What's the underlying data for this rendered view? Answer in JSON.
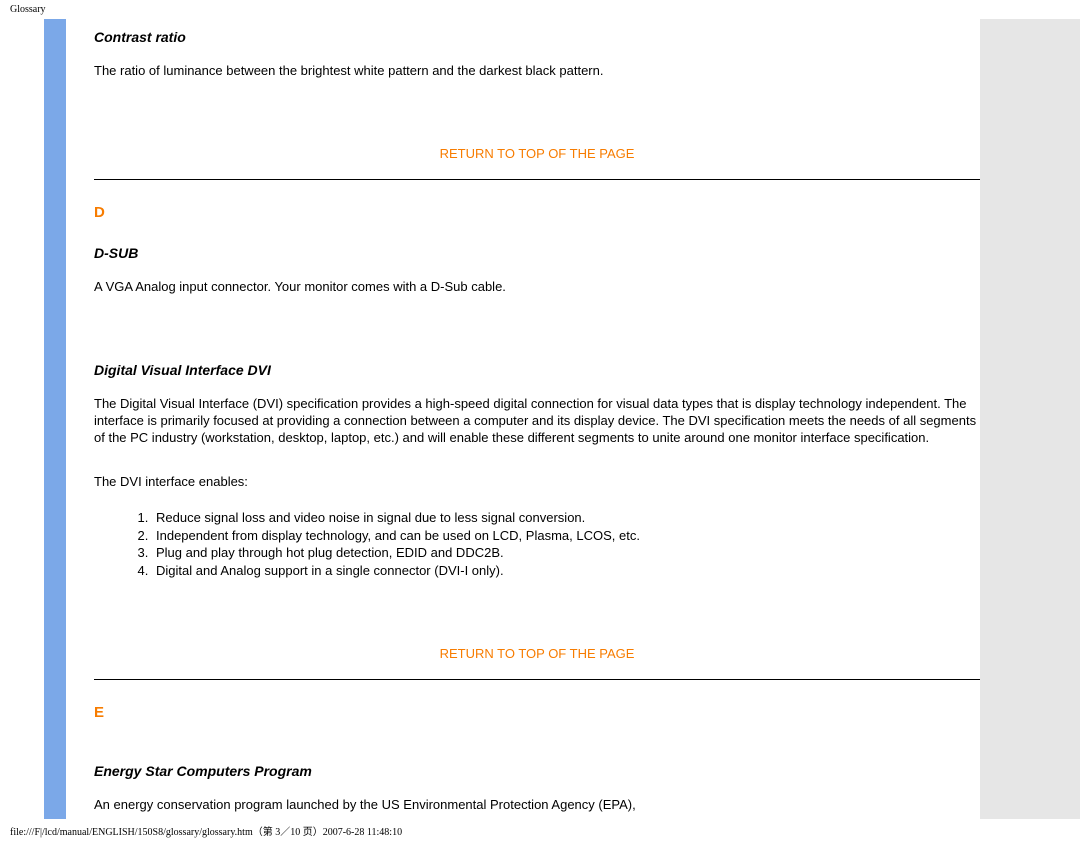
{
  "header": {
    "title": "Glossary"
  },
  "sections": {
    "contrast_ratio": {
      "title": "Contrast ratio",
      "body": "The ratio of luminance between the brightest white pattern and the darkest black pattern."
    },
    "return_link": "RETURN TO TOP OF THE PAGE",
    "letter_d": "D",
    "dsub": {
      "title": "D-SUB",
      "body": "A VGA Analog input connector. Your monitor comes with a D-Sub cable."
    },
    "dvi": {
      "title": "Digital Visual Interface DVI",
      "body1": "The Digital Visual Interface (DVI) specification provides a high-speed digital connection for visual data types that is display technology independent. The interface is primarily focused at providing a connection between a computer and its display device. The DVI specification meets the needs of all segments of the PC industry (workstation, desktop, laptop, etc.) and will enable these different segments to unite around one monitor interface specification.",
      "body2": "The DVI interface enables:",
      "list": [
        "Reduce signal loss and video noise in signal due to less signal conversion.",
        "Independent from display technology, and can be used on LCD, Plasma, LCOS, etc.",
        "Plug and play through hot plug detection, EDID and DDC2B.",
        "Digital and Analog support in a single connector (DVI-I only)."
      ]
    },
    "letter_e": "E",
    "energy_star": {
      "title": "Energy Star Computers Program",
      "body": "An energy conservation program launched by the US Environmental Protection Agency (EPA),"
    }
  },
  "footer": {
    "text": "file:///F|/lcd/manual/ENGLISH/150S8/glossary/glossary.htm（第 3／10 页）2007-6-28 11:48:10"
  }
}
